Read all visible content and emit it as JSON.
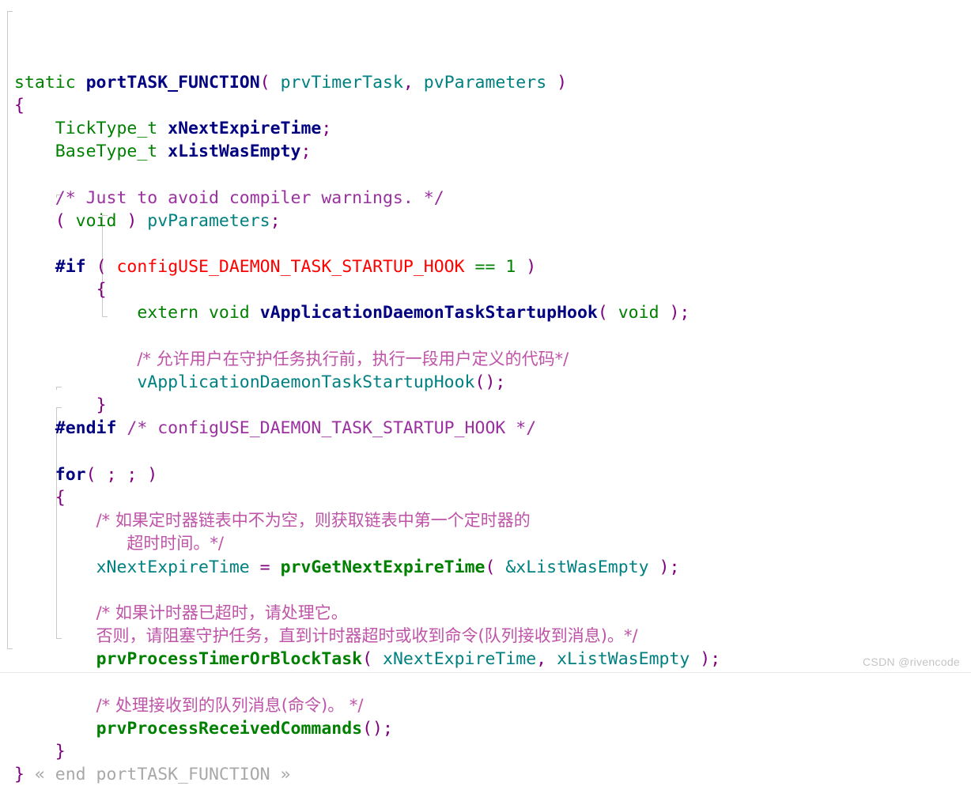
{
  "editor": {
    "language": "C",
    "theme_background": "#ffffff",
    "fold_marker_start": "«",
    "fold_marker_end": "»"
  },
  "colors": {
    "keyword": "#000080",
    "type": "#008000",
    "punctuation": "#800080",
    "macro": "#ff0000",
    "number": "#008000",
    "function": "#008000",
    "variable": "#008080",
    "comment": "#9b30a0",
    "comment_cjk": "#bf53a8",
    "fold_text": "#a8a8a8",
    "guide_line": "#c9c9c9",
    "watermark": "#c4c4c4"
  },
  "watermark": {
    "text": "CSDN @rivencode"
  },
  "code": {
    "lines": [
      {
        "n": 1,
        "tokens": [
          {
            "t": "static ",
            "c": "type"
          },
          {
            "t": "portTASK_FUNCTION",
            "c": "kw"
          },
          {
            "t": "(",
            "c": "punct"
          },
          {
            "t": " prvTimerTask",
            "c": "var"
          },
          {
            "t": ",",
            "c": "punct"
          },
          {
            "t": " pvParameters ",
            "c": "var"
          },
          {
            "t": ")",
            "c": "punct"
          }
        ]
      },
      {
        "n": 2,
        "tokens": [
          {
            "t": "{",
            "c": "punct"
          }
        ]
      },
      {
        "n": 3,
        "tokens": [
          {
            "t": "    ",
            "c": "plain"
          },
          {
            "t": "TickType_t ",
            "c": "type"
          },
          {
            "t": "xNextExpireTime",
            "c": "kw"
          },
          {
            "t": ";",
            "c": "punct"
          }
        ]
      },
      {
        "n": 4,
        "tokens": [
          {
            "t": "    ",
            "c": "plain"
          },
          {
            "t": "BaseType_t ",
            "c": "type"
          },
          {
            "t": "xListWasEmpty",
            "c": "kw"
          },
          {
            "t": ";",
            "c": "punct"
          }
        ]
      },
      {
        "n": 5,
        "tokens": []
      },
      {
        "n": 6,
        "tokens": [
          {
            "t": "    ",
            "c": "plain"
          },
          {
            "t": "/* Just to avoid compiler warnings. */",
            "c": "cmt"
          }
        ]
      },
      {
        "n": 7,
        "tokens": [
          {
            "t": "    ",
            "c": "plain"
          },
          {
            "t": "( ",
            "c": "punct"
          },
          {
            "t": "void",
            "c": "type"
          },
          {
            "t": " ) ",
            "c": "punct"
          },
          {
            "t": "pvParameters",
            "c": "var"
          },
          {
            "t": ";",
            "c": "punct"
          }
        ]
      },
      {
        "n": 8,
        "tokens": []
      },
      {
        "n": 9,
        "tokens": [
          {
            "t": "    ",
            "c": "plain"
          },
          {
            "t": "#if",
            "c": "kw"
          },
          {
            "t": " ( ",
            "c": "punct"
          },
          {
            "t": "configUSE_DAEMON_TASK_STARTUP_HOOK",
            "c": "macro"
          },
          {
            "t": " == 1",
            "c": "num"
          },
          {
            "t": " )",
            "c": "punct"
          }
        ]
      },
      {
        "n": 10,
        "tokens": [
          {
            "t": "        ",
            "c": "plain"
          },
          {
            "t": "{",
            "c": "punct"
          }
        ]
      },
      {
        "n": 11,
        "tokens": [
          {
            "t": "            ",
            "c": "plain"
          },
          {
            "t": "extern void ",
            "c": "type"
          },
          {
            "t": "vApplicationDaemonTaskStartupHook",
            "c": "kw"
          },
          {
            "t": "( ",
            "c": "punct"
          },
          {
            "t": "void",
            "c": "type"
          },
          {
            "t": " );",
            "c": "punct"
          }
        ]
      },
      {
        "n": 12,
        "tokens": []
      },
      {
        "n": 13,
        "tokens": [
          {
            "t": "            ",
            "c": "plain"
          },
          {
            "t": "/* 允许用户在守护任务执行前，执行一段用户定义的代码*/",
            "c": "cmt-cn"
          }
        ]
      },
      {
        "n": 14,
        "tokens": [
          {
            "t": "            ",
            "c": "plain"
          },
          {
            "t": "vApplicationDaemonTaskStartupHook",
            "c": "var"
          },
          {
            "t": "();",
            "c": "punct"
          }
        ]
      },
      {
        "n": 15,
        "tokens": [
          {
            "t": "        ",
            "c": "plain"
          },
          {
            "t": "}",
            "c": "punct"
          }
        ]
      },
      {
        "n": 16,
        "tokens": [
          {
            "t": "    ",
            "c": "plain"
          },
          {
            "t": "#endif",
            "c": "kw"
          },
          {
            "t": " /* configUSE_DAEMON_TASK_STARTUP_HOOK */",
            "c": "cmt"
          }
        ]
      },
      {
        "n": 17,
        "tokens": []
      },
      {
        "n": 18,
        "tokens": [
          {
            "t": "    ",
            "c": "plain"
          },
          {
            "t": "for",
            "c": "kw"
          },
          {
            "t": "( ; ; )",
            "c": "punct"
          }
        ]
      },
      {
        "n": 19,
        "tokens": [
          {
            "t": "    ",
            "c": "plain"
          },
          {
            "t": "{",
            "c": "punct"
          }
        ]
      },
      {
        "n": 20,
        "tokens": [
          {
            "t": "        ",
            "c": "plain"
          },
          {
            "t": "/* 如果定时器链表中不为空，则获取链表中第一个定时器的",
            "c": "cmt-cn"
          }
        ]
      },
      {
        "n": 21,
        "tokens": [
          {
            "t": "           ",
            "c": "plain"
          },
          {
            "t": "超时时间。*/",
            "c": "cmt-cn"
          }
        ]
      },
      {
        "n": 22,
        "tokens": [
          {
            "t": "        ",
            "c": "plain"
          },
          {
            "t": "xNextExpireTime",
            "c": "var"
          },
          {
            "t": " = ",
            "c": "punct"
          },
          {
            "t": "prvGetNextExpireTime",
            "c": "fn"
          },
          {
            "t": "(",
            "c": "punct"
          },
          {
            "t": " &xListWasEmpty ",
            "c": "var"
          },
          {
            "t": ");",
            "c": "punct"
          }
        ]
      },
      {
        "n": 23,
        "tokens": []
      },
      {
        "n": 24,
        "tokens": [
          {
            "t": "        ",
            "c": "plain"
          },
          {
            "t": "/* 如果计时器已超时，请处理它。",
            "c": "cmt-cn"
          }
        ]
      },
      {
        "n": 25,
        "tokens": [
          {
            "t": "        ",
            "c": "plain"
          },
          {
            "t": "否则，请阻塞守护任务，直到计时器超时或收到命令(队列接收到消息)。*/",
            "c": "cmt-cn"
          }
        ]
      },
      {
        "n": 26,
        "tokens": [
          {
            "t": "        ",
            "c": "plain"
          },
          {
            "t": "prvProcessTimerOrBlockTask",
            "c": "fn"
          },
          {
            "t": "(",
            "c": "punct"
          },
          {
            "t": " xNextExpireTime",
            "c": "var"
          },
          {
            "t": ",",
            "c": "punct"
          },
          {
            "t": " xListWasEmpty ",
            "c": "var"
          },
          {
            "t": ");",
            "c": "punct"
          }
        ]
      },
      {
        "n": 27,
        "tokens": []
      },
      {
        "n": 28,
        "tokens": [
          {
            "t": "        ",
            "c": "plain"
          },
          {
            "t": "/* 处理接收到的队列消息(命令)。 */",
            "c": "cmt-cn"
          }
        ]
      },
      {
        "n": 29,
        "tokens": [
          {
            "t": "        ",
            "c": "plain"
          },
          {
            "t": "prvProcessReceivedCommands",
            "c": "fn"
          },
          {
            "t": "();",
            "c": "punct"
          }
        ]
      },
      {
        "n": 30,
        "tokens": [
          {
            "t": "    ",
            "c": "plain"
          },
          {
            "t": "}",
            "c": "punct"
          }
        ]
      },
      {
        "n": 31,
        "tokens": [
          {
            "t": "}",
            "c": "punct"
          },
          {
            "t": " « end portTASK_FUNCTION »",
            "c": "fold-txt"
          }
        ]
      }
    ]
  }
}
